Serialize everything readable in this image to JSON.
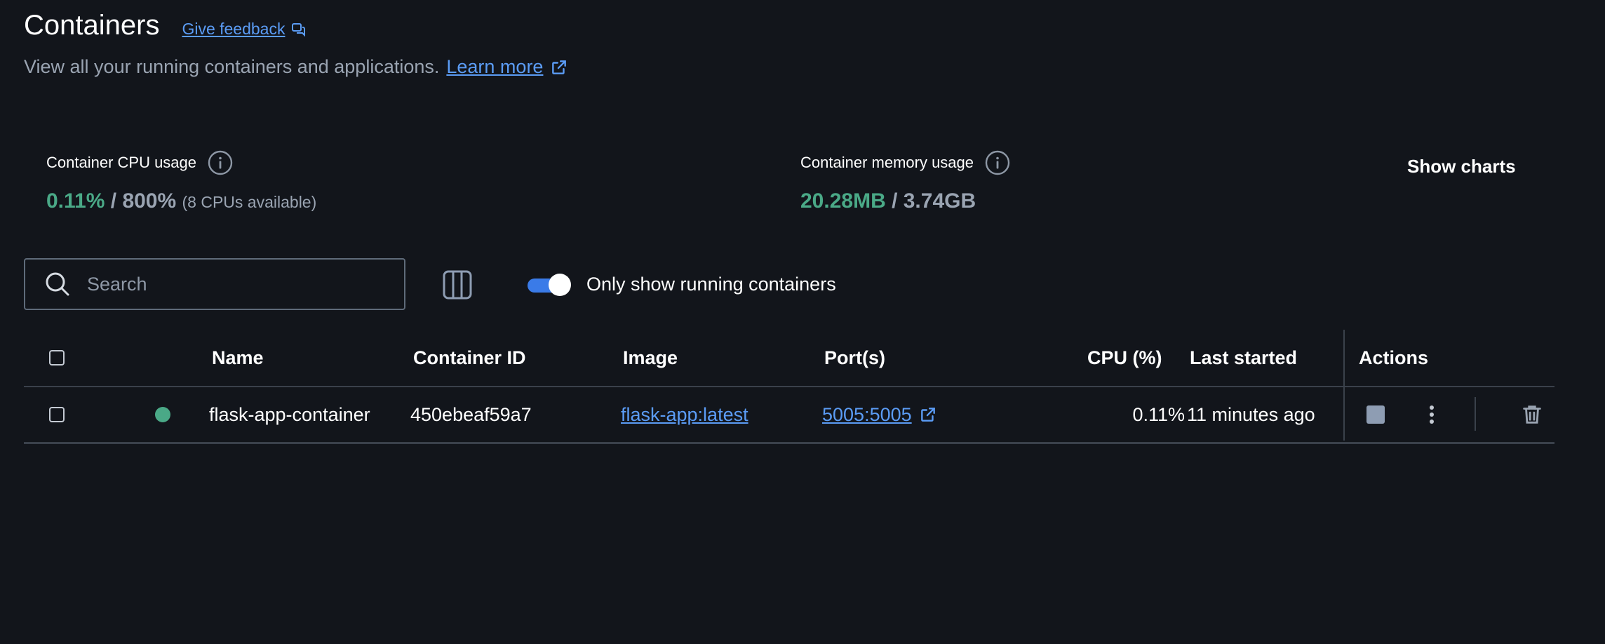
{
  "header": {
    "title": "Containers",
    "feedback_label": "Give feedback",
    "subtitle": "View all your running containers and applications.",
    "learn_more_label": "Learn more"
  },
  "stats": {
    "cpu": {
      "label": "Container CPU usage",
      "used": "0.11%",
      "separator": " / ",
      "total": "800%",
      "note": "(8 CPUs available)"
    },
    "memory": {
      "label": "Container memory usage",
      "used": "20.28MB",
      "separator": " / ",
      "total": "3.74GB"
    },
    "show_charts_label": "Show charts"
  },
  "toolbar": {
    "search_placeholder": "Search",
    "search_value": "",
    "toggle_label": "Only show running containers",
    "toggle_on": true
  },
  "table": {
    "headers": {
      "name": "Name",
      "container_id": "Container ID",
      "image": "Image",
      "ports": "Port(s)",
      "cpu": "CPU (%)",
      "last_started": "Last started",
      "actions": "Actions"
    },
    "rows": [
      {
        "status": "running",
        "name": "flask-app-container",
        "container_id": "450ebeaf59a7",
        "image": "flask-app:latest",
        "ports": "5005:5005",
        "cpu": "0.11%",
        "last_started": "11 minutes ago"
      }
    ]
  },
  "colors": {
    "background": "#12151b",
    "accent_link": "#5b9cf5",
    "status_green": "#4aa987",
    "toggle_blue": "#3a7be8",
    "muted_text": "#9aa4b2"
  },
  "icons": {
    "feedback": "chat-bubble-icon",
    "external": "external-link-icon",
    "info": "info-icon",
    "search": "search-icon",
    "columns": "columns-icon",
    "stop": "stop-icon",
    "more": "more-vertical-icon",
    "delete": "trash-icon"
  }
}
